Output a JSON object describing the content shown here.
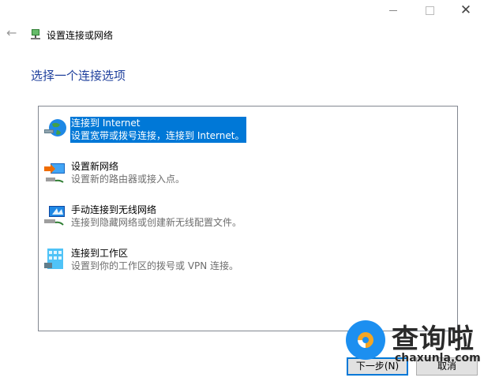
{
  "window": {
    "title": "设置连接或网络",
    "controls": [
      "minimize",
      "maximize",
      "close"
    ]
  },
  "heading": "选择一个连接选项",
  "options": [
    {
      "title": "连接到 Internet",
      "description": "设置宽带或拨号连接，连接到 Internet。",
      "icon": "globe-network-icon",
      "selected": true
    },
    {
      "title": "设置新网络",
      "description": "设置新的路由器或接入点。",
      "icon": "new-network-icon",
      "selected": false
    },
    {
      "title": "手动连接到无线网络",
      "description": "连接到隐藏网络或创建新无线配置文件。",
      "icon": "wireless-monitor-icon",
      "selected": false
    },
    {
      "title": "连接到工作区",
      "description": "设置到你的工作区的拨号或 VPN 连接。",
      "icon": "workplace-icon",
      "selected": false
    }
  ],
  "buttons": {
    "next": "下一步(N)",
    "cancel": "取消"
  },
  "watermark": {
    "brand": "查询啦",
    "url": "chaxunla.com"
  },
  "colors": {
    "accent": "#0078d7",
    "heading": "#1e3f9c"
  }
}
